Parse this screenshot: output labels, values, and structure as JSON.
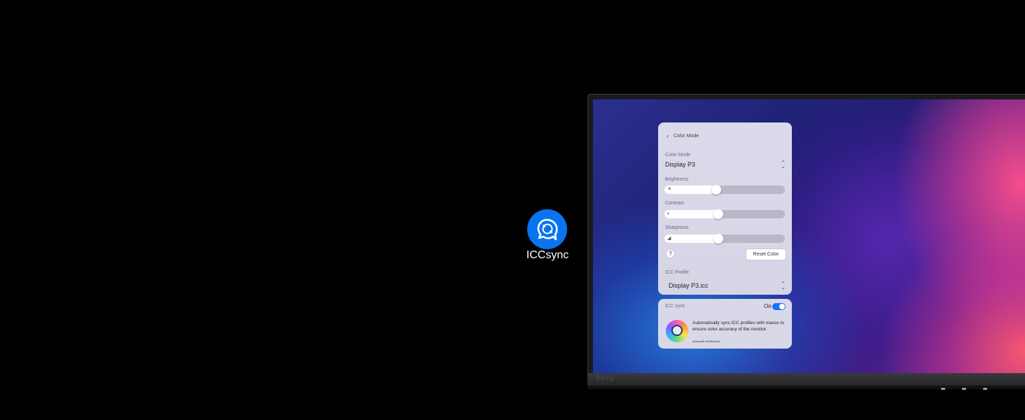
{
  "app_badge": {
    "name": "ICCsync",
    "color": "#0a74f0"
  },
  "monitor": {
    "brand": "BenQ"
  },
  "panel": {
    "back_label": "Color Mode",
    "color_mode_label": "Color Mode",
    "color_mode_value": "Display P3",
    "brightness_label": "Brightness",
    "brightness_level": 0.42,
    "contrast_label": "Contrast",
    "contrast_level": 0.44,
    "sharpness_label": "Sharpness",
    "sharpness_level": 0.44,
    "help_label": "?",
    "reset_label": "Reset Color",
    "icc_profile_label": "ICC Profile",
    "icc_profile_value": "Display P3.icc"
  },
  "sync_panel": {
    "title": "ICC sync",
    "toggle_label": "On",
    "toggle_on": true,
    "accent": "#1a73f5",
    "description": "Automatically sync ICC profiles with macos to ensure color accuracy of the monitor.",
    "fine_print": "dAhdoaB-UiDISkyUsb"
  },
  "icons": {
    "back": "chevron-left-icon",
    "brightness": "sun-icon",
    "contrast": "contrast-icon",
    "sharpness": "sharpness-icon",
    "select": "chevron-updown-icon"
  }
}
